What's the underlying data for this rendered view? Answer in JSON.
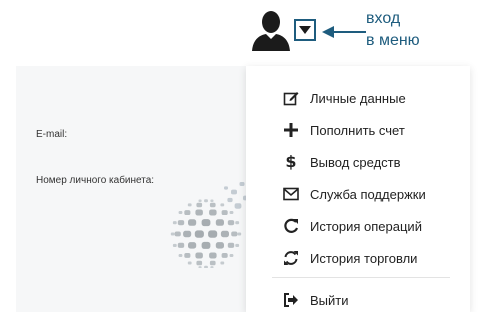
{
  "annotation": {
    "line1": "вход",
    "line2": "в меню",
    "color": "#1e5c7e"
  },
  "header": {
    "avatar_icon": "user-silhouette-icon",
    "toggle_icon": "caret-down-icon"
  },
  "profile_panel": {
    "email_label": "E-mail:",
    "account_number_label": "Номер личного кабинета:"
  },
  "menu": {
    "items": [
      {
        "label": "Личные данные",
        "icon": "edit-icon"
      },
      {
        "label": "Пополнить счет",
        "icon": "plus-icon"
      },
      {
        "label": "Вывод средств",
        "icon": "dollar-icon"
      },
      {
        "label": "Служба поддержки",
        "icon": "envelope-icon"
      },
      {
        "label": "История операций",
        "icon": "redo-icon"
      },
      {
        "label": "История торговли",
        "icon": "refresh-icon"
      }
    ],
    "logout": {
      "label": "Выйти",
      "icon": "sign-out-icon"
    }
  }
}
